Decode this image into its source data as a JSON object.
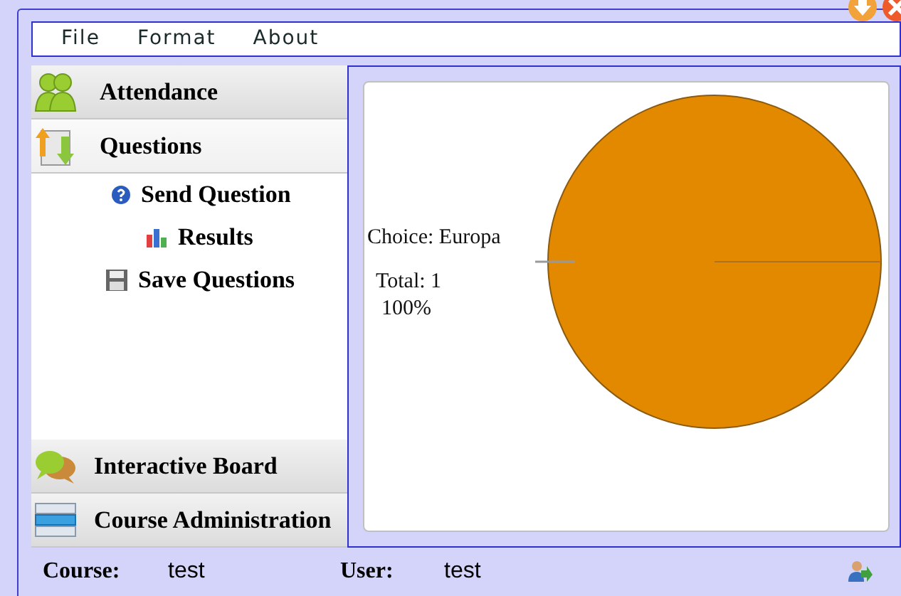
{
  "menu": [
    "File",
    "Format",
    "About"
  ],
  "sidebar": {
    "sections": [
      {
        "label": "Attendance",
        "expanded": false
      },
      {
        "label": "Questions",
        "expanded": true,
        "children": [
          {
            "label": "Send Question"
          },
          {
            "label": "Results"
          },
          {
            "label": "Save Questions"
          }
        ]
      },
      {
        "label": "Interactive Board",
        "expanded": false
      },
      {
        "label": "Course Administration",
        "expanded": false
      }
    ]
  },
  "chart": {
    "choice_label": "Choice: Europa",
    "total_label": "Total: 1",
    "percent_label": "100%"
  },
  "status_bar": {
    "course_label": "Course:",
    "course_value": "test",
    "user_label": "User:",
    "user_value": "test"
  }
}
